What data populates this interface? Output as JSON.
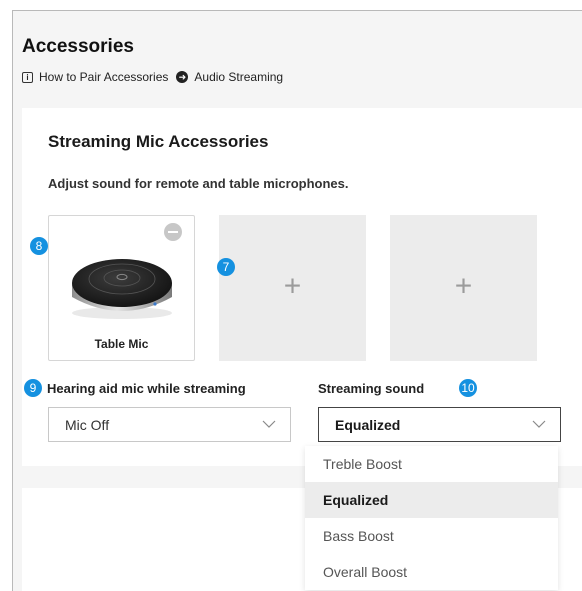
{
  "header": {
    "title": "Accessories",
    "links": [
      {
        "label": "How to Pair Accessories",
        "icon": "info-icon"
      },
      {
        "label": "Audio Streaming",
        "icon": "arrow-circle-icon"
      }
    ]
  },
  "section": {
    "title": "Streaming Mic Accessories",
    "description": "Adjust sound for remote and table microphones."
  },
  "slots": [
    {
      "label": "Table Mic",
      "state": "paired"
    },
    {
      "label": "",
      "state": "empty"
    },
    {
      "label": "",
      "state": "empty"
    }
  ],
  "plus_glyph": "+",
  "markers": [
    "8",
    "7",
    "9",
    "10"
  ],
  "hearing_aid_mic": {
    "label": "Hearing aid mic while streaming",
    "value": "Mic Off"
  },
  "streaming_sound": {
    "label": "Streaming sound",
    "value": "Equalized",
    "options": [
      "Treble Boost",
      "Equalized",
      "Bass Boost",
      "Overall Boost"
    ],
    "selected_index": 1
  },
  "colors": {
    "marker": "#1591e0",
    "empty_slot": "#ececec",
    "selected_option": "#ececec"
  }
}
